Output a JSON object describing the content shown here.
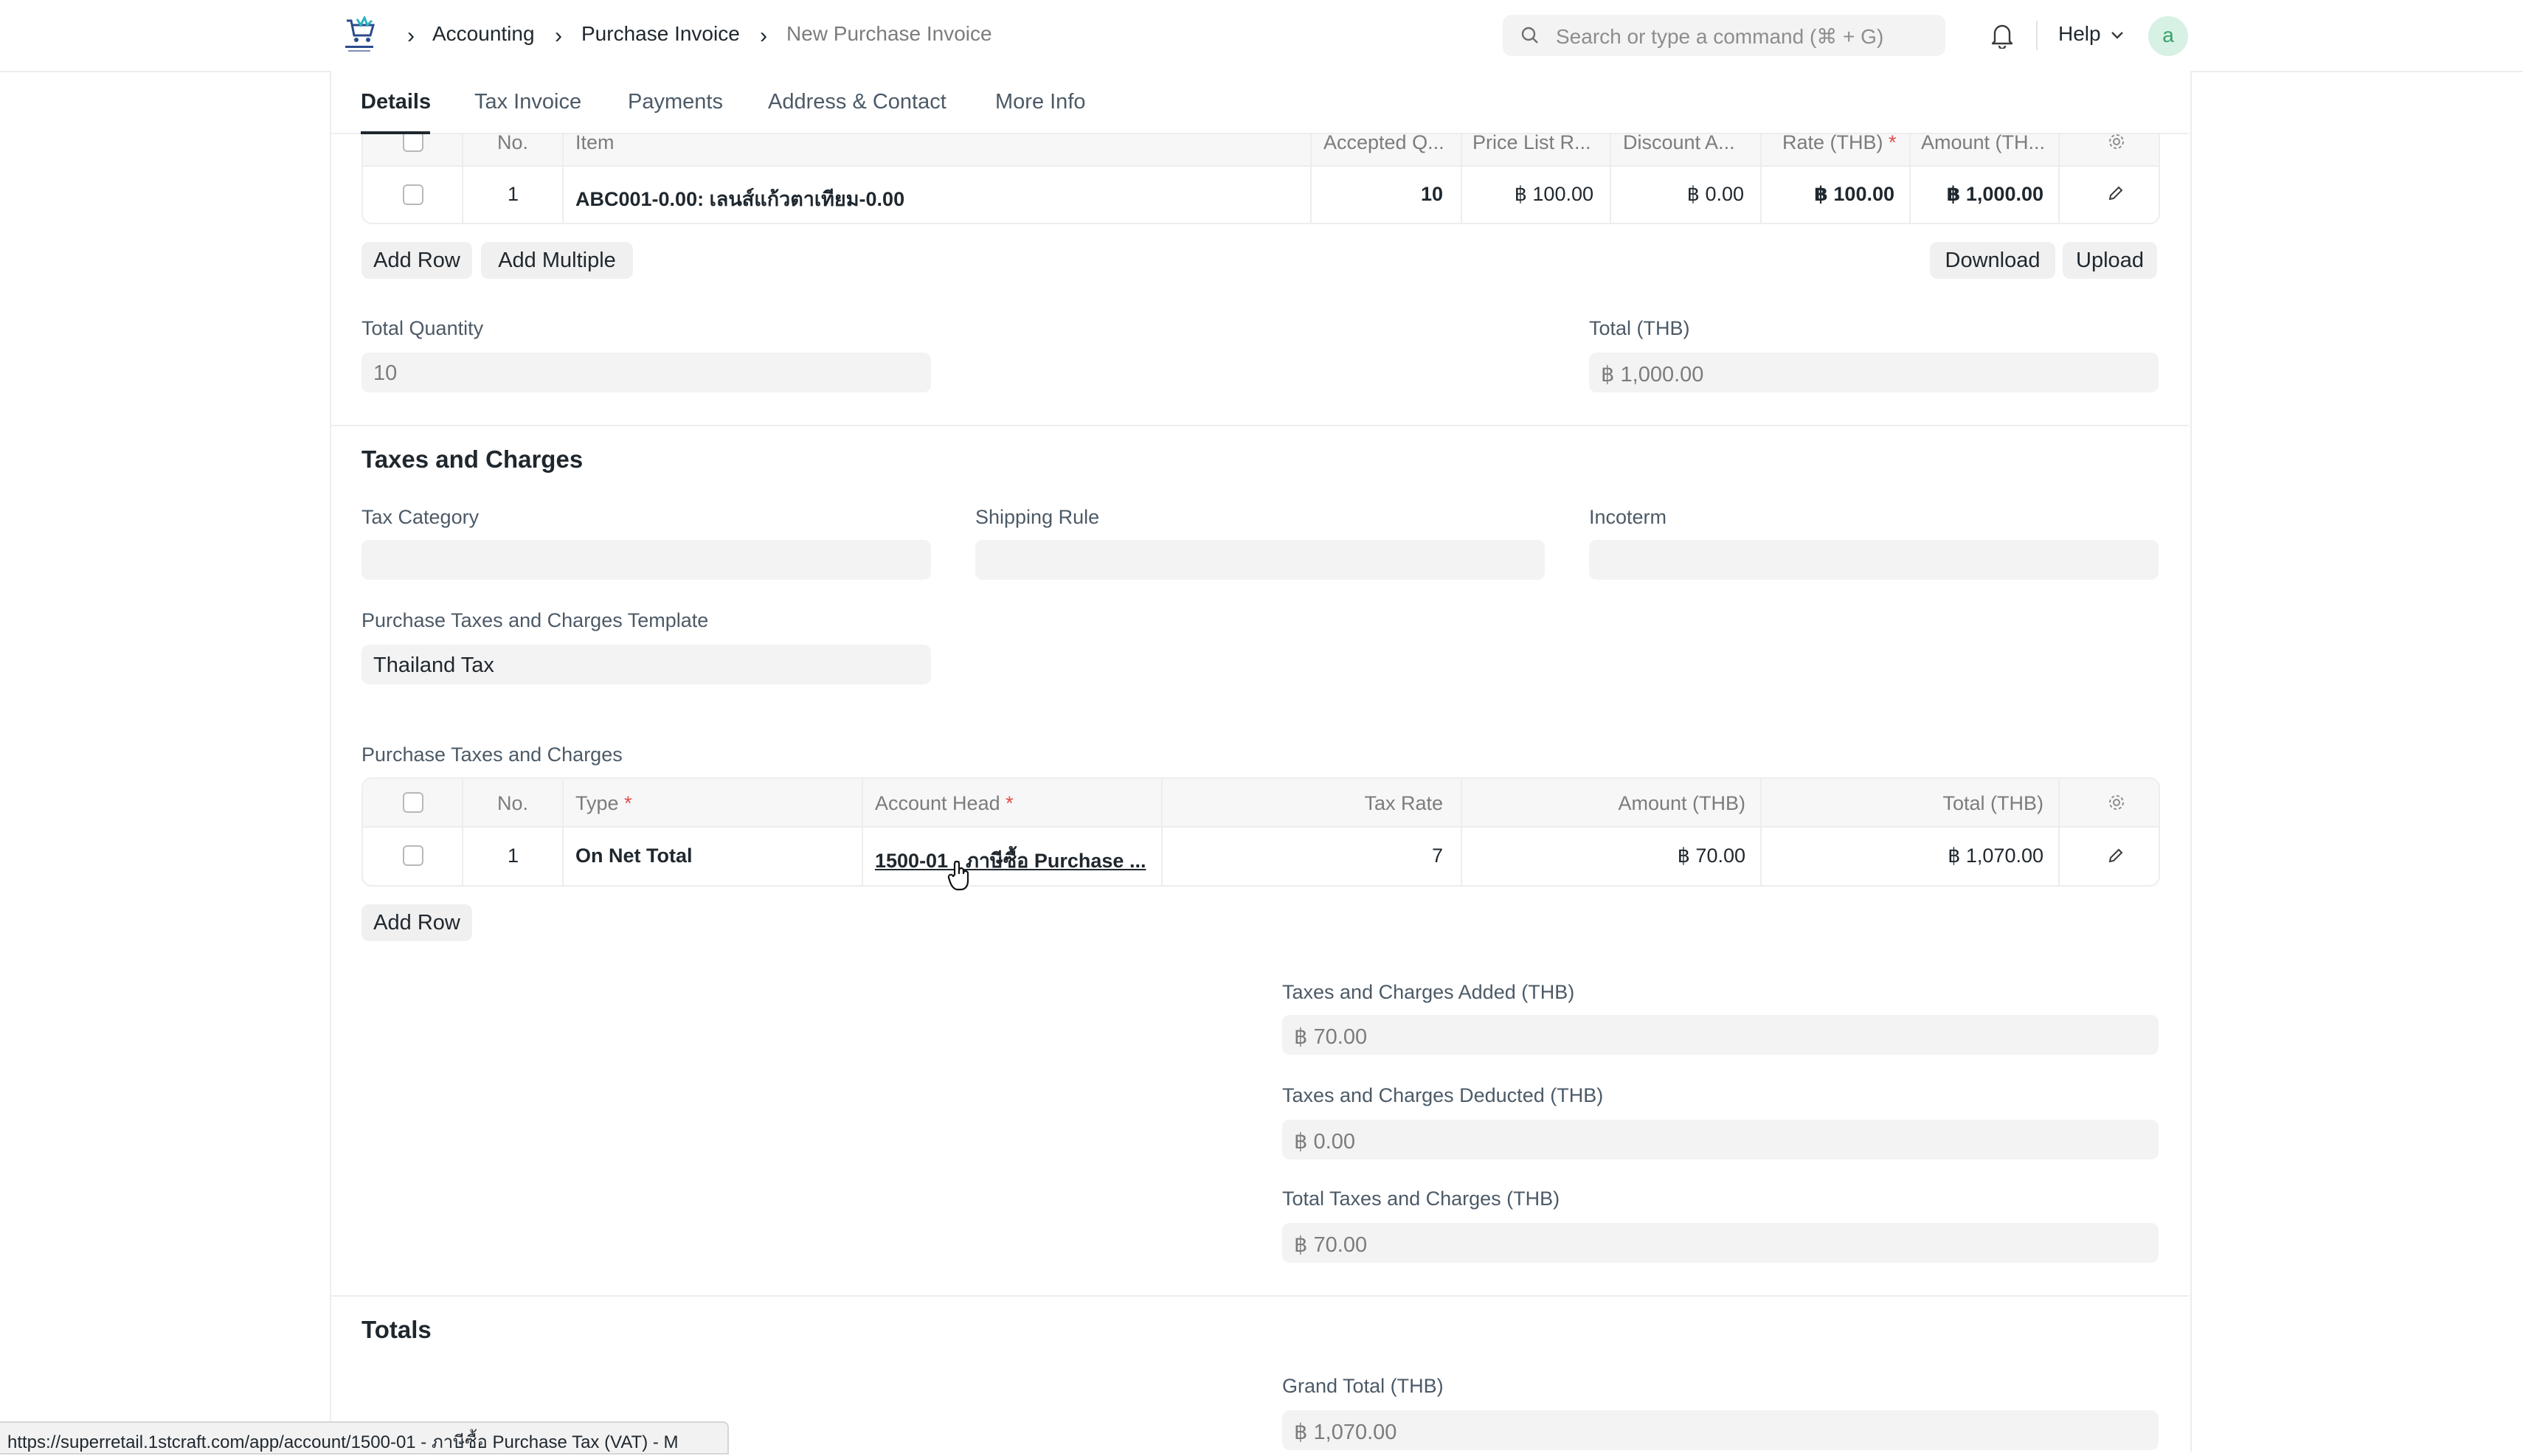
{
  "breadcrumb": {
    "items": [
      "Accounting",
      "Purchase Invoice",
      "New Purchase Invoice"
    ]
  },
  "search": {
    "placeholder": "Search or type a command (⌘ + G)"
  },
  "navbar": {
    "help_label": "Help",
    "avatar_initial": "a"
  },
  "tabs": [
    "Details",
    "Tax Invoice",
    "Payments",
    "Address & Contact",
    "More Info"
  ],
  "items_table": {
    "headers": [
      "No.",
      "Item",
      "Accepted Q...",
      "Price List R...",
      "Discount A...",
      "Rate (THB)",
      "Amount (TH..."
    ],
    "rows": [
      {
        "no": "1",
        "item": "ABC001-0.00: เลนส์แก้วตาเทียม-0.00",
        "accepted_qty": "10",
        "price_list_rate": "฿ 100.00",
        "discount_amount": "฿ 0.00",
        "rate": "฿ 100.00",
        "amount": "฿ 1,000.00"
      }
    ],
    "add_row": "Add Row",
    "add_multiple": "Add Multiple",
    "download": "Download",
    "upload": "Upload"
  },
  "totals_top": {
    "total_quantity_label": "Total Quantity",
    "total_quantity": "10",
    "total_label": "Total (THB)",
    "total": "฿ 1,000.00"
  },
  "taxes_section": {
    "title": "Taxes and Charges",
    "tax_category_label": "Tax Category",
    "tax_category": "",
    "shipping_rule_label": "Shipping Rule",
    "shipping_rule": "",
    "incoterm_label": "Incoterm",
    "incoterm": "",
    "template_label": "Purchase Taxes and Charges Template",
    "template": "Thailand Tax",
    "table_label": "Purchase Taxes and Charges"
  },
  "taxes_table": {
    "headers": [
      "No.",
      "Type",
      "Account Head",
      "Tax Rate",
      "Amount (THB)",
      "Total (THB)"
    ],
    "rows": [
      {
        "no": "1",
        "type": "On Net Total",
        "account_head": "1500-01 - ภาษีซื้อ Purchase ...",
        "tax_rate": "7",
        "amount": "฿ 70.00",
        "total": "฿ 1,070.00"
      }
    ],
    "add_row": "Add Row"
  },
  "tax_totals": {
    "added_label": "Taxes and Charges Added (THB)",
    "added": "฿ 70.00",
    "deducted_label": "Taxes and Charges Deducted (THB)",
    "deducted": "฿ 0.00",
    "total_label": "Total Taxes and Charges (THB)",
    "total": "฿ 70.00"
  },
  "totals_section": {
    "title": "Totals",
    "grand_total_label": "Grand Total (THB)",
    "grand_total": "฿ 1,070.00"
  },
  "status_bar": {
    "url": "https://superretail.1stcraft.com/app/account/1500-01 - ภาษีซื้อ Purchase Tax (VAT) - M"
  },
  "colors": {
    "required": "#e24c4c",
    "avatar_bg": "#d7f1e4",
    "avatar_fg": "#36a26c"
  }
}
